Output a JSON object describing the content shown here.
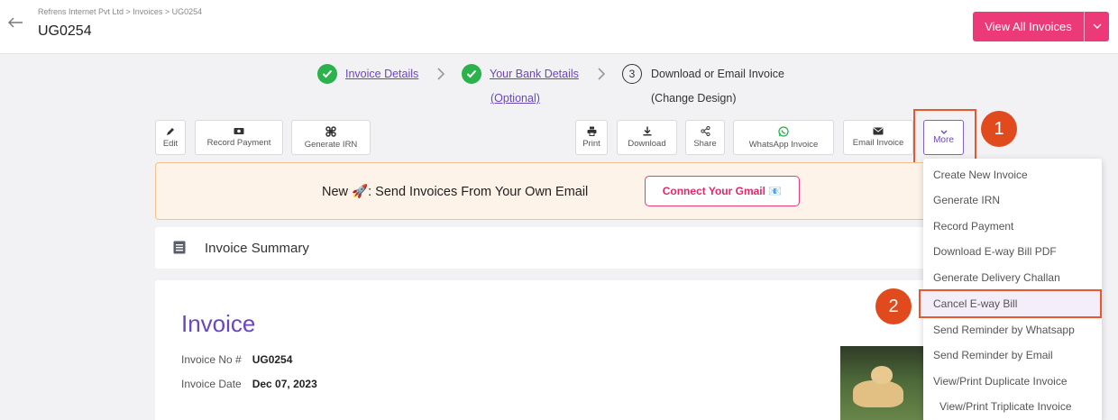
{
  "header": {
    "breadcrumb": "Refrens Internet Pvt Ltd  >  Invoices  >  UG0254",
    "title": "UG0254",
    "view_all_label": "View All Invoices"
  },
  "stepper": {
    "step1": "Invoice Details",
    "step2": "Your Bank Details",
    "step2_sub": "(Optional)",
    "step3_num": "3",
    "step3": "Download or Email Invoice",
    "step3_sub": "(Change Design)"
  },
  "toolbar": {
    "edit": "Edit",
    "record_payment": "Record Payment",
    "generate_irn": "Generate IRN",
    "print": "Print",
    "download": "Download",
    "share": "Share",
    "whatsapp": "WhatsApp Invoice",
    "email": "Email Invoice",
    "more": "More"
  },
  "banner": {
    "text": "New 🚀: Send Invoices From Your Own Email",
    "connect": "Connect Your Gmail 📧"
  },
  "summary": {
    "title": "Invoice Summary"
  },
  "invoice": {
    "title": "Invoice",
    "no_label": "Invoice No #",
    "no_value": "UG0254",
    "date_label": "Invoice Date",
    "date_value": "Dec 07, 2023"
  },
  "badges": {
    "one": "1",
    "two": "2"
  },
  "menu": {
    "items": [
      "Create New Invoice",
      "Generate IRN",
      "Record Payment",
      "Download E-way Bill PDF",
      "Generate Delivery Challan",
      "Cancel E-way Bill",
      "Send Reminder by Whatsapp",
      "Send Reminder by Email",
      "View/Print Duplicate Invoice",
      "View/Print Triplicate Invoice"
    ]
  },
  "colors": {
    "brand_pink": "#ec3977",
    "accent_purple": "#6b46c1",
    "success_green": "#2bb24c",
    "annotation_orange": "#e04a1c"
  }
}
